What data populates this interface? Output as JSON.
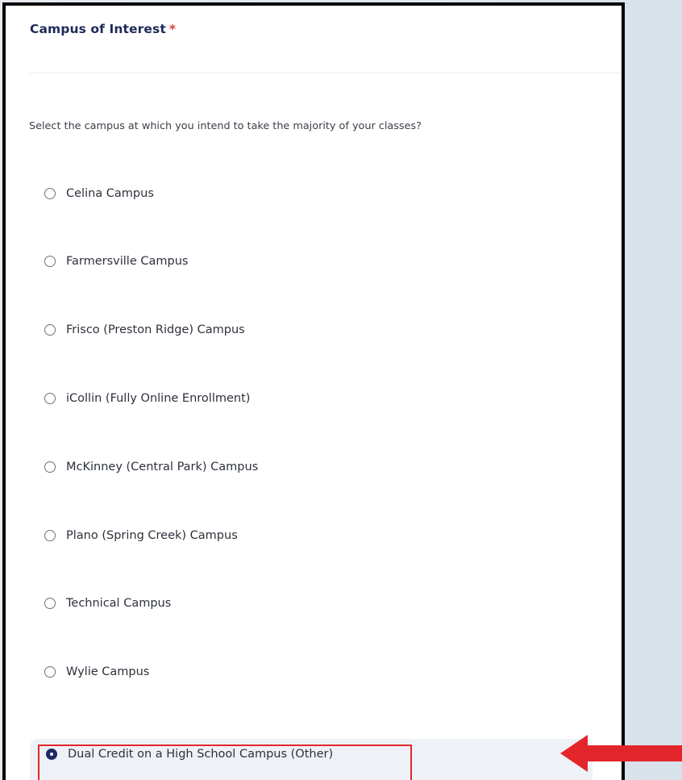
{
  "question": {
    "title": "Campus of Interest",
    "required_mark": "*",
    "prompt": "Select the campus at which you intend to take the majority of your classes?"
  },
  "options": [
    {
      "label": "Celina Campus",
      "selected": false
    },
    {
      "label": "Farmersville Campus",
      "selected": false
    },
    {
      "label": "Frisco (Preston Ridge) Campus",
      "selected": false
    },
    {
      "label": "iCollin (Fully Online Enrollment)",
      "selected": false
    },
    {
      "label": "McKinney (Central Park) Campus",
      "selected": false
    },
    {
      "label": "Plano (Spring Creek) Campus",
      "selected": false
    },
    {
      "label": "Technical Campus",
      "selected": false
    },
    {
      "label": "Wylie Campus",
      "selected": false
    },
    {
      "label": "Dual Credit on a High School Campus (Other)",
      "selected": true
    }
  ],
  "colors": {
    "title": "#1f2a5a",
    "required": "#e03a3a",
    "highlight_box": "#e3262b",
    "arrow": "#e3262b",
    "radio_selected": "#1e2a63"
  },
  "icons": {
    "annotation": "left-arrow-icon"
  }
}
